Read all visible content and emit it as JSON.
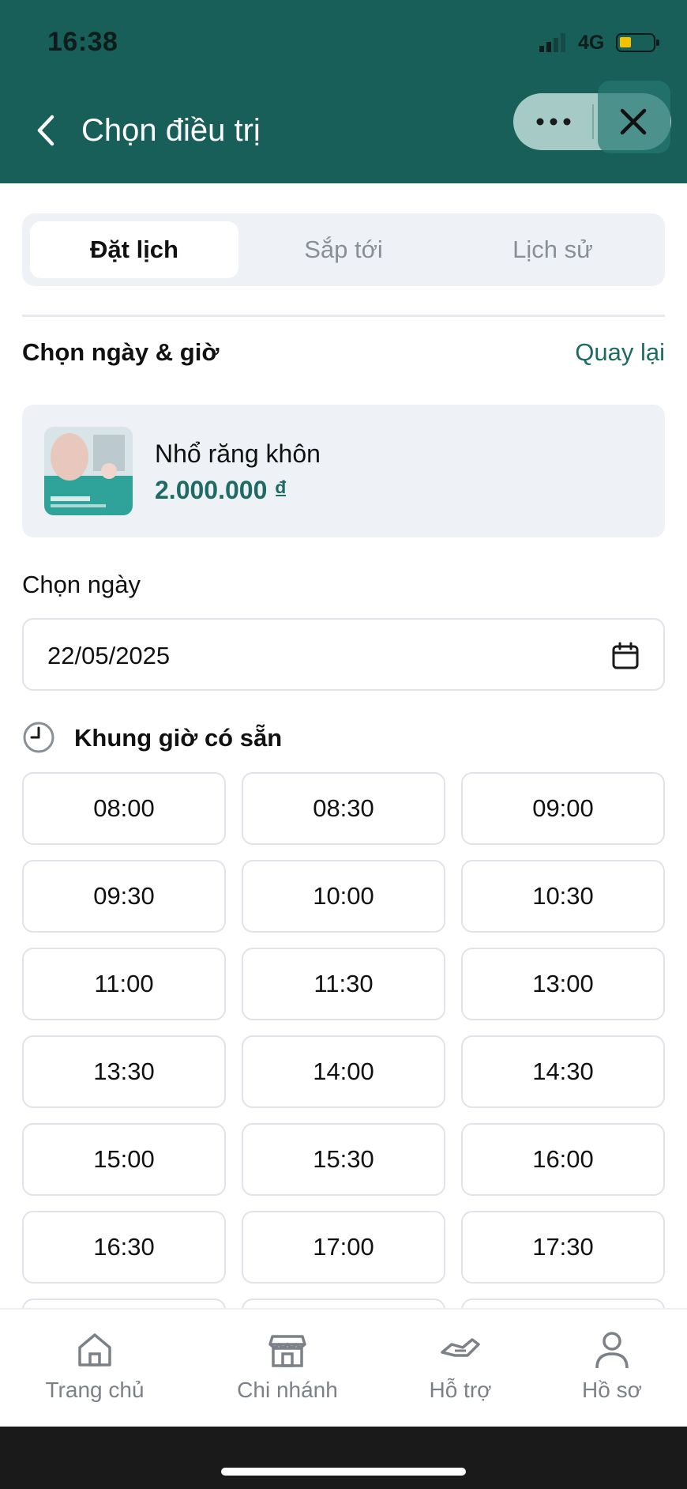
{
  "status_bar": {
    "time": "16:38",
    "network": "4G"
  },
  "header": {
    "title": "Chọn điều trị"
  },
  "tabs": [
    {
      "label": "Đặt lịch",
      "active": true
    },
    {
      "label": "Sắp tới",
      "active": false
    },
    {
      "label": "Lịch sử",
      "active": false
    }
  ],
  "section": {
    "title": "Chọn ngày & giờ",
    "back_link": "Quay lại"
  },
  "service": {
    "name": "Nhổ răng khôn",
    "price": "2.000.000 ₫"
  },
  "date_picker": {
    "label": "Chọn ngày",
    "value": "22/05/2025"
  },
  "slots": {
    "title": "Khung giờ có sẵn",
    "times": [
      "08:00",
      "08:30",
      "09:00",
      "09:30",
      "10:00",
      "10:30",
      "11:00",
      "11:30",
      "13:00",
      "13:30",
      "14:00",
      "14:30",
      "15:00",
      "15:30",
      "16:00",
      "16:30",
      "17:00",
      "17:30"
    ]
  },
  "bottom_nav": [
    {
      "label": "Trang chủ",
      "icon": "home-icon"
    },
    {
      "label": "Chi nhánh",
      "icon": "store-icon"
    },
    {
      "label": "Hỗ trợ",
      "icon": "handshake-icon"
    },
    {
      "label": "Hồ sơ",
      "icon": "user-icon"
    }
  ],
  "colors": {
    "primary": "#185f59",
    "accent": "#1e6b63",
    "surface": "#eef2f7"
  }
}
